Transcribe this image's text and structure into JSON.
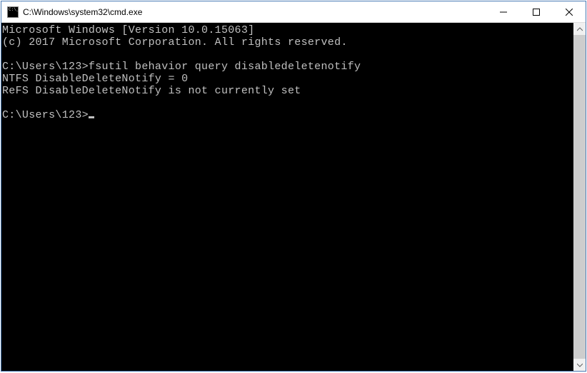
{
  "window": {
    "title": "C:\\Windows\\system32\\cmd.exe"
  },
  "terminal": {
    "line1": "Microsoft Windows [Version 10.0.15063]",
    "line2": "(c) 2017 Microsoft Corporation. All rights reserved.",
    "blank1": "",
    "prompt1": "C:\\Users\\123>",
    "command1": "fsutil behavior query disabledeletenotify",
    "output1": "NTFS DisableDeleteNotify = 0",
    "output2": "ReFS DisableDeleteNotify is not currently set",
    "blank2": "",
    "prompt2": "C:\\Users\\123>"
  }
}
